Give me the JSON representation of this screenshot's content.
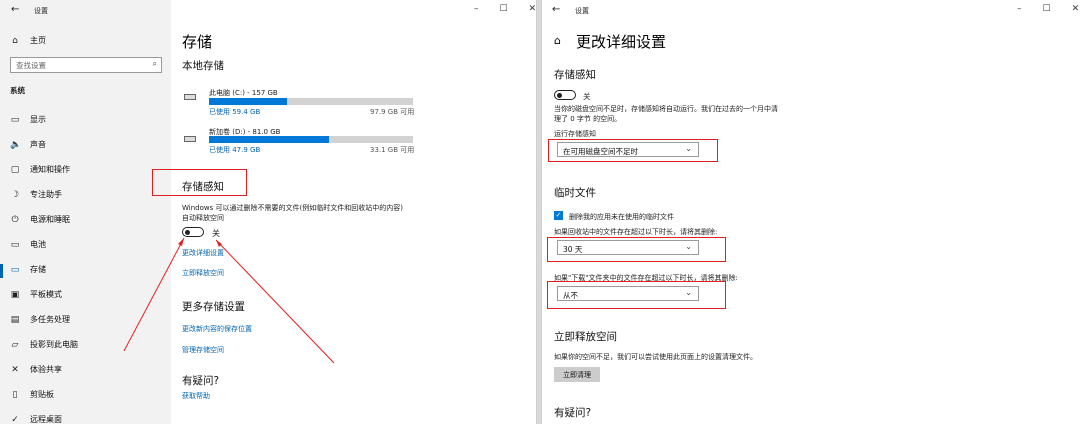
{
  "left": {
    "titlebar": {
      "title": "设置",
      "controls": [
        "–",
        "☐",
        "✕"
      ]
    },
    "sidebar": {
      "home": "主页",
      "search_placeholder": "查找设置",
      "section": "系统",
      "items": [
        {
          "label": "显示",
          "icon": "display-icon"
        },
        {
          "label": "声音",
          "icon": "sound-icon"
        },
        {
          "label": "通知和操作",
          "icon": "notification-icon"
        },
        {
          "label": "专注助手",
          "icon": "focus-assist-icon"
        },
        {
          "label": "电源和睡眠",
          "icon": "power-icon"
        },
        {
          "label": "电池",
          "icon": "battery-icon"
        },
        {
          "label": "存储",
          "icon": "storage-icon"
        },
        {
          "label": "平板模式",
          "icon": "tablet-icon"
        },
        {
          "label": "多任务处理",
          "icon": "multitask-icon"
        },
        {
          "label": "投影到此电脑",
          "icon": "project-icon"
        },
        {
          "label": "体验共享",
          "icon": "share-icon"
        },
        {
          "label": "剪贴板",
          "icon": "clipboard-icon"
        },
        {
          "label": "远程桌面",
          "icon": "remote-desktop-icon"
        }
      ]
    },
    "main": {
      "title": "存储",
      "local_storage": "本地存储",
      "drives": [
        {
          "name": "此电脑 (C:) - 157 GB",
          "used": "已使用 59.4 GB",
          "free": "97.9 GB 可用",
          "fraction": 0.38
        },
        {
          "name": "新加卷 (D:) - 81.0 GB",
          "used": "已使用 47.9 GB",
          "free": "33.1 GB 可用",
          "fraction": 0.59
        }
      ],
      "storage_sense": "存储感知",
      "storage_sense_desc1": "Windows 可以通过删除不需要的文件(例如临时文件和回收站中的内容)",
      "storage_sense_desc2": "自动释放空间",
      "toggle_label": "关",
      "link_change": "更改详细设置",
      "link_free_now": "立即释放空间",
      "more_settings": "更多存储设置",
      "link_new_content": "更改新内容的保存位置",
      "link_manage": "管理存储空间",
      "question": "有疑问?",
      "get_help": "获取帮助"
    }
  },
  "right": {
    "titlebar": {
      "title": "设置",
      "controls": [
        "–",
        "☐",
        "✕"
      ]
    },
    "page_title": "更改详细设置",
    "storage_sense": "存储感知",
    "toggle_label": "关",
    "desc1": "当你的磁盘空间不足时，存储感知将自动运行。我们在过去的一个月中清",
    "desc2": "理了 0 字节 的空间。",
    "run_label": "运行存储感知",
    "run_value": "在可用磁盘空间不足时",
    "temp_files": "临时文件",
    "checkbox_label": "删除我的应用未在使用的临时文件",
    "recycle_label": "如果回收站中的文件存在超过以下时长，请将其删除:",
    "recycle_value": "30 天",
    "downloads_label": "如果\"下载\"文件夹中的文件存在超过以下时长，请将其删除:",
    "downloads_value": "从不",
    "free_now": "立即释放空间",
    "free_now_desc": "如果你的空间不足，我们可以尝试使用此页面上的设置清理文件。",
    "clean_button": "立即清理",
    "question": "有疑问?"
  },
  "colors": {
    "accent": "#0078d7",
    "link": "#0063b1",
    "annotation": "#e02020"
  }
}
